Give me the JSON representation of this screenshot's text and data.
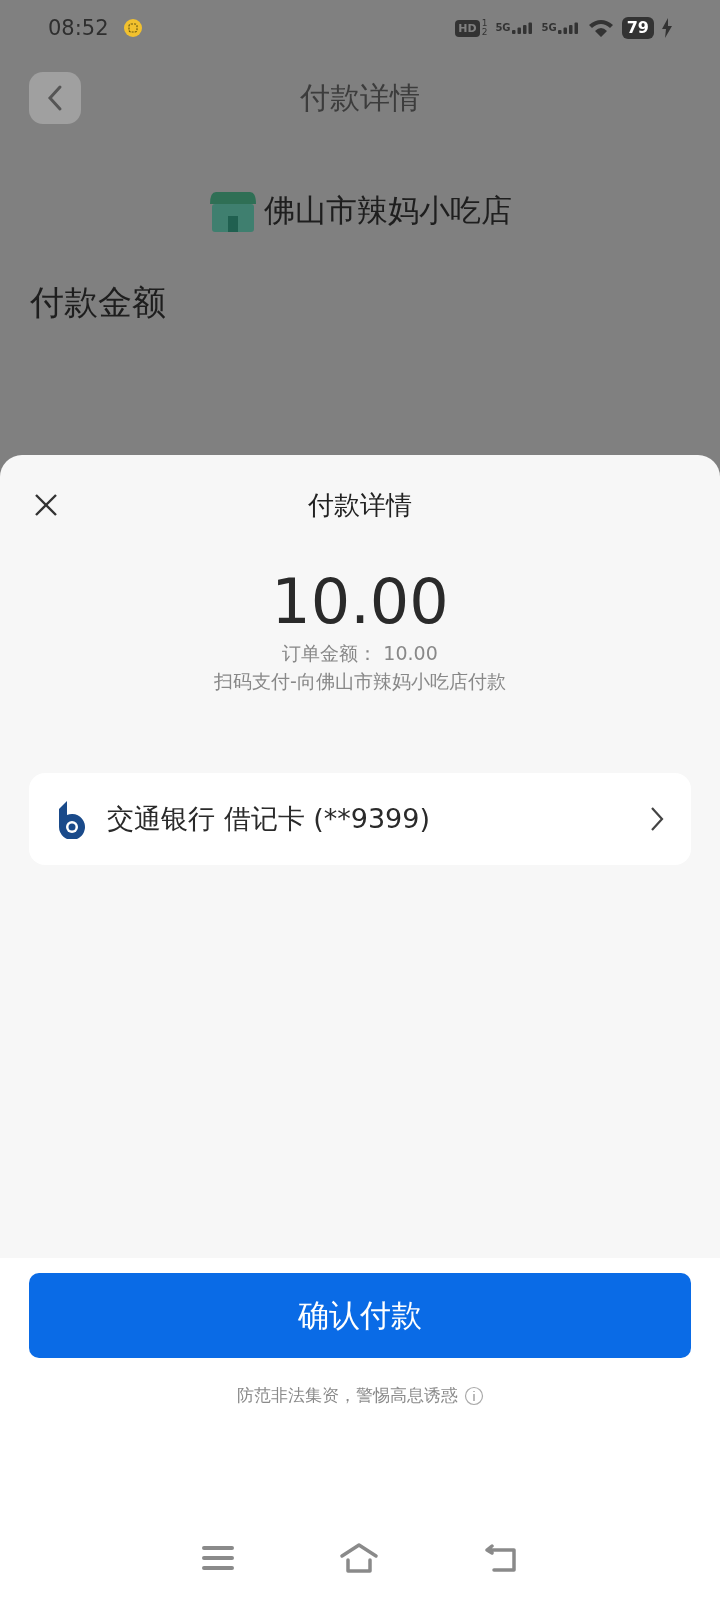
{
  "status_bar": {
    "time": "08:52",
    "hd": "HD",
    "hd_slots": [
      "1",
      "2"
    ],
    "networks": [
      "5G",
      "5G"
    ],
    "battery": "79"
  },
  "page": {
    "title": "付款详情",
    "merchant": "佛山市辣妈小吃店",
    "amount_label": "付款金额"
  },
  "sheet": {
    "title": "付款详情",
    "amount": "10.00",
    "order_amount": "订单金额： 10.00",
    "description": "扫码支付-向佛山市辣妈小吃店付款",
    "payment_method": {
      "bank": "交通银行",
      "card": "借记卡 (**9399)"
    },
    "confirm_button": "确认付款",
    "notice": "防范非法集资，警惕高息诱惑"
  }
}
